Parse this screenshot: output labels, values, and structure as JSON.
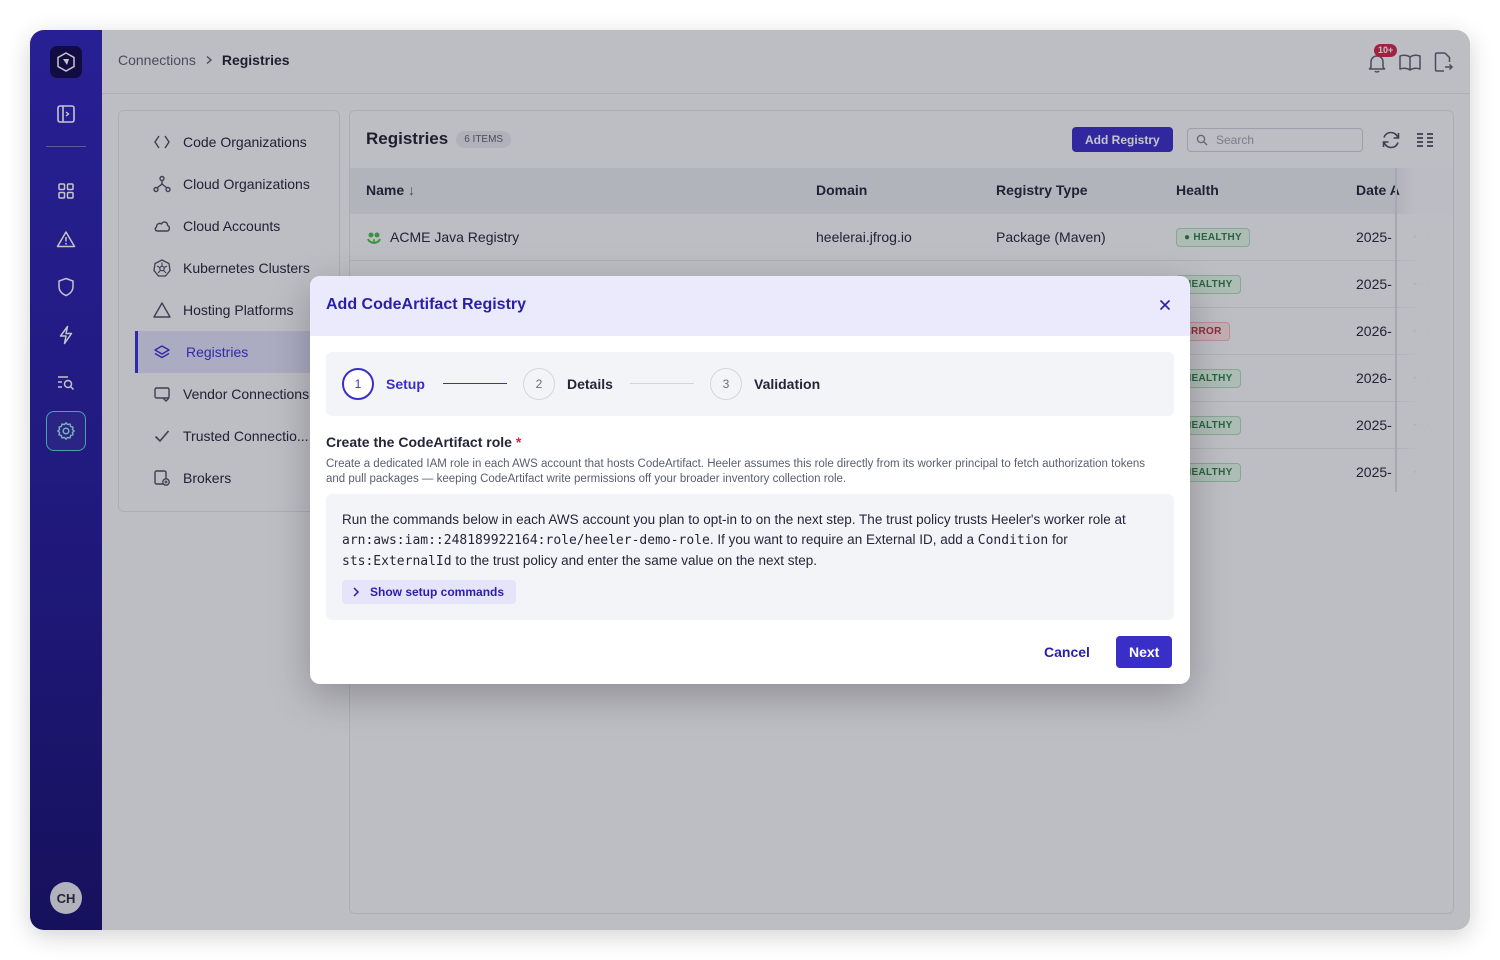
{
  "breadcrumb": {
    "parent": "Connections",
    "current": "Registries"
  },
  "notifications": {
    "badge": "10+"
  },
  "user": {
    "initials": "CH"
  },
  "sidenav": {
    "items": [
      {
        "label": "Code Organizations",
        "icon": "code-icon"
      },
      {
        "label": "Cloud Organizations",
        "icon": "org-tree-icon"
      },
      {
        "label": "Cloud Accounts",
        "icon": "cloud-icon"
      },
      {
        "label": "Kubernetes Clusters",
        "icon": "kubernetes-icon"
      },
      {
        "label": "Hosting Platforms",
        "icon": "triangle-icon"
      },
      {
        "label": "Registries",
        "icon": "layers-icon",
        "active": true
      },
      {
        "label": "Vendor Connections",
        "icon": "vendor-icon"
      },
      {
        "label": "Trusted Connectio...",
        "icon": "check-icon"
      },
      {
        "label": "Brokers",
        "icon": "broker-icon"
      }
    ]
  },
  "registries": {
    "title": "Registries",
    "count": "6 ITEMS",
    "add_button": "Add Registry",
    "search_placeholder": "Search",
    "columns": [
      "Name",
      "Domain",
      "Registry Type",
      "Health",
      "Date A"
    ],
    "rows": [
      {
        "name": "ACME Java Registry",
        "domain": "heelerai.jfrog.io",
        "type": "Package (Maven)",
        "health": "HEALTHY",
        "date": "2025-"
      },
      {
        "name": "",
        "domain": "",
        "type": "",
        "health": "HEALTHY",
        "date": "2025-"
      },
      {
        "name": "",
        "domain": "",
        "type": "",
        "health": "ERROR",
        "date": "2026-"
      },
      {
        "name": "",
        "domain": "",
        "type": "",
        "health": "HEALTHY",
        "date": "2026-"
      },
      {
        "name": "",
        "domain": "",
        "type": "",
        "health": "HEALTHY",
        "date": "2025-"
      },
      {
        "name": "",
        "domain": "",
        "type": "",
        "health": "HEALTHY",
        "date": "2025-"
      }
    ],
    "row_menu": "···"
  },
  "modal": {
    "title": "Add CodeArtifact Registry",
    "steps": [
      {
        "num": "1",
        "label": "Setup"
      },
      {
        "num": "2",
        "label": "Details"
      },
      {
        "num": "3",
        "label": "Validation"
      }
    ],
    "section_title": "Create the CodeArtifact role",
    "required_mark": "*",
    "section_desc": "Create a dedicated IAM role in each AWS account that hosts CodeArtifact. Heeler assumes this role directly from its worker principal to fetch authorization tokens and pull packages — keeping CodeArtifact write permissions off your broader inventory collection role.",
    "info": {
      "part1": "Run the commands below in each AWS account you plan to opt-in to on the next step. The trust policy trusts Heeler's worker role at ",
      "role_arn": "arn:aws:iam::248189922164:role/heeler-demo-role",
      "part2": ". If you want to require an External ID, add a ",
      "condition": "Condition",
      "part3": " for ",
      "external_id": "sts:ExternalId",
      "part4": " to the trust policy and enter the same value on the next step."
    },
    "show_commands": "Show setup commands",
    "cancel": "Cancel",
    "next": "Next"
  },
  "colors": {
    "accent": "#3a2ec9",
    "rail": "#2d23b8",
    "healthy": "#2f7d47",
    "error": "#b8323c"
  }
}
